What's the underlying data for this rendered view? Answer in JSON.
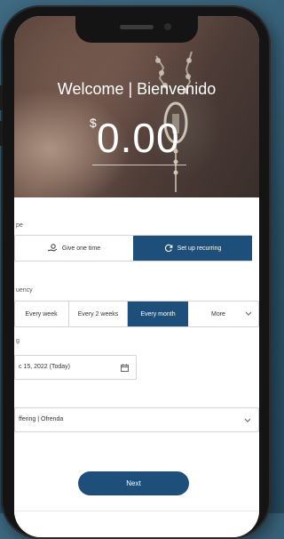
{
  "header": {
    "welcome": "Welcome | Bienvenido",
    "currency_symbol": "$",
    "amount": "0.00"
  },
  "type_section": {
    "label": "pe",
    "options": [
      {
        "label": "Give one time",
        "icon": "hand-coin-icon",
        "active": false
      },
      {
        "label": "Set up recurring",
        "icon": "refresh-icon",
        "active": true
      }
    ]
  },
  "frequency_section": {
    "label": "uency",
    "options": [
      {
        "label": "Every week",
        "active": false
      },
      {
        "label": "Every 2 weeks",
        "active": false
      },
      {
        "label": "Every month",
        "active": true
      },
      {
        "label": "More",
        "active": false
      }
    ]
  },
  "date_section": {
    "label": "g",
    "value": "c 15, 2022 (Today)"
  },
  "fund_section": {
    "value": "ffering | Ofrenda"
  },
  "next_button": "Next",
  "colors": {
    "primary": "#1d4f7a",
    "background": "#2b5269"
  }
}
